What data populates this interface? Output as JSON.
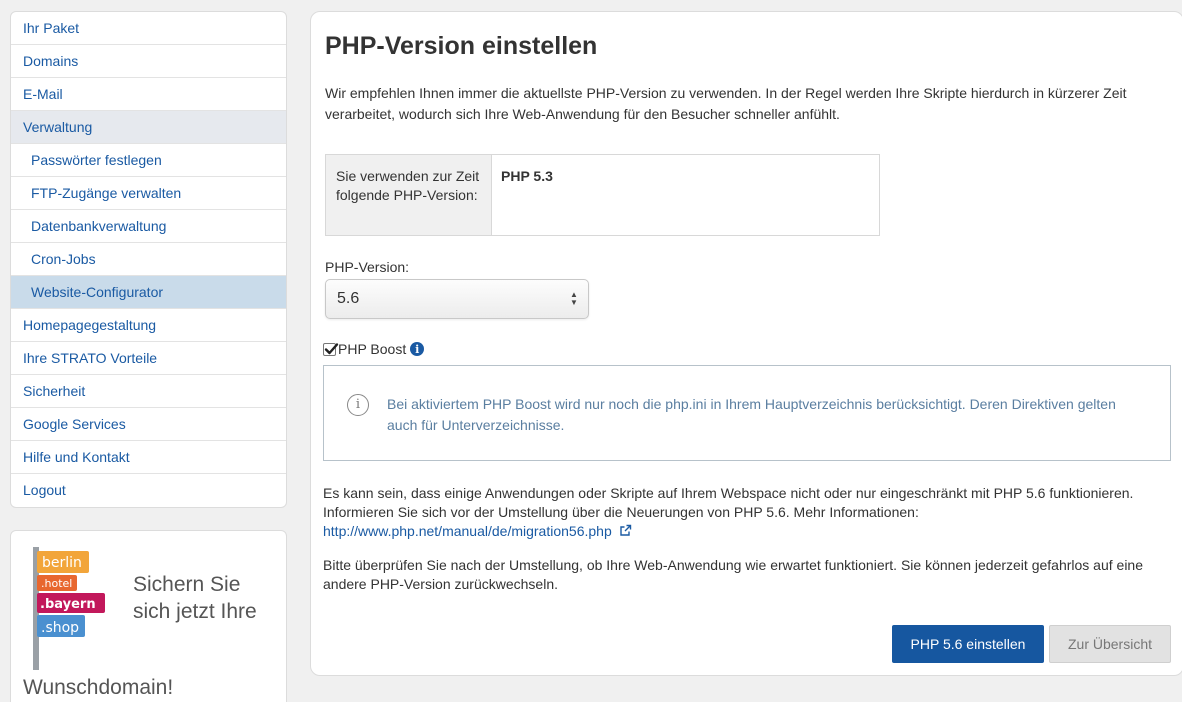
{
  "sidebar": {
    "items": [
      {
        "label": "Ihr Paket"
      },
      {
        "label": "Domains"
      },
      {
        "label": "E-Mail"
      },
      {
        "label": "Verwaltung"
      },
      {
        "label": "Passwörter festlegen"
      },
      {
        "label": "FTP-Zugänge verwalten"
      },
      {
        "label": "Datenbankverwaltung"
      },
      {
        "label": "Cron-Jobs"
      },
      {
        "label": "Website-Configurator"
      },
      {
        "label": "Homepagegestaltung"
      },
      {
        "label": "Ihre STRATO Vorteile"
      },
      {
        "label": "Sicherheit"
      },
      {
        "label": "Google Services"
      },
      {
        "label": "Hilfe und Kontakt"
      },
      {
        "label": "Logout"
      }
    ],
    "selected_item": "Website-Configurator"
  },
  "promo": {
    "sign_labels": [
      "berlin",
      ".hotel",
      ".bayern",
      ".shop"
    ],
    "headline": "Sichern Sie sich jetzt Ihre",
    "footer": "Wunschdomain!"
  },
  "main": {
    "title": "PHP-Version einstellen",
    "intro": "Wir empfehlen Ihnen immer die aktuellste PHP-Version zu verwenden. In der Regel werden Ihre Skripte hierdurch in kürzerer Zeit verarbeitet, wodurch sich Ihre Web-Anwendung für den Besucher schneller anfühlt.",
    "current": {
      "label": "Sie verwenden zur Zeit folgende PHP-Version:",
      "value": "PHP 5.3"
    },
    "select": {
      "label": "PHP-Version:",
      "value": "5.6"
    },
    "boost": {
      "label": "PHP Boost",
      "checked": true
    },
    "notice": "Bei aktiviertem PHP Boost wird nur noch die php.ini in Ihrem Hauptverzeichnis berücksichtigt. Deren Direktiven gelten auch für Unterverzeichnisse.",
    "para1_text": "Es kann sein, dass einige Anwendungen oder Skripte auf Ihrem Webspace nicht oder nur eingeschränkt mit PHP 5.6 funktionieren. Informieren Sie sich vor der Umstellung über die Neuerungen von PHP 5.6. Mehr Informationen:",
    "para1_link": "http://www.php.net/manual/de/migration56.php",
    "para2": "Bitte überprüfen Sie nach der Umstellung, ob Ihre Web-Anwendung wie erwartet funktioniert. Sie können jederzeit gefahrlos auf eine andere PHP-Version zurückwechseln.",
    "primary_button": "PHP 5.6 einstellen",
    "secondary_button": "Zur Übersicht"
  },
  "colors": {
    "link": "#1a5aa3",
    "primary_button": "#1657a0",
    "selected_nav": "#c9dbea",
    "notice_text": "#5a7ea0"
  }
}
